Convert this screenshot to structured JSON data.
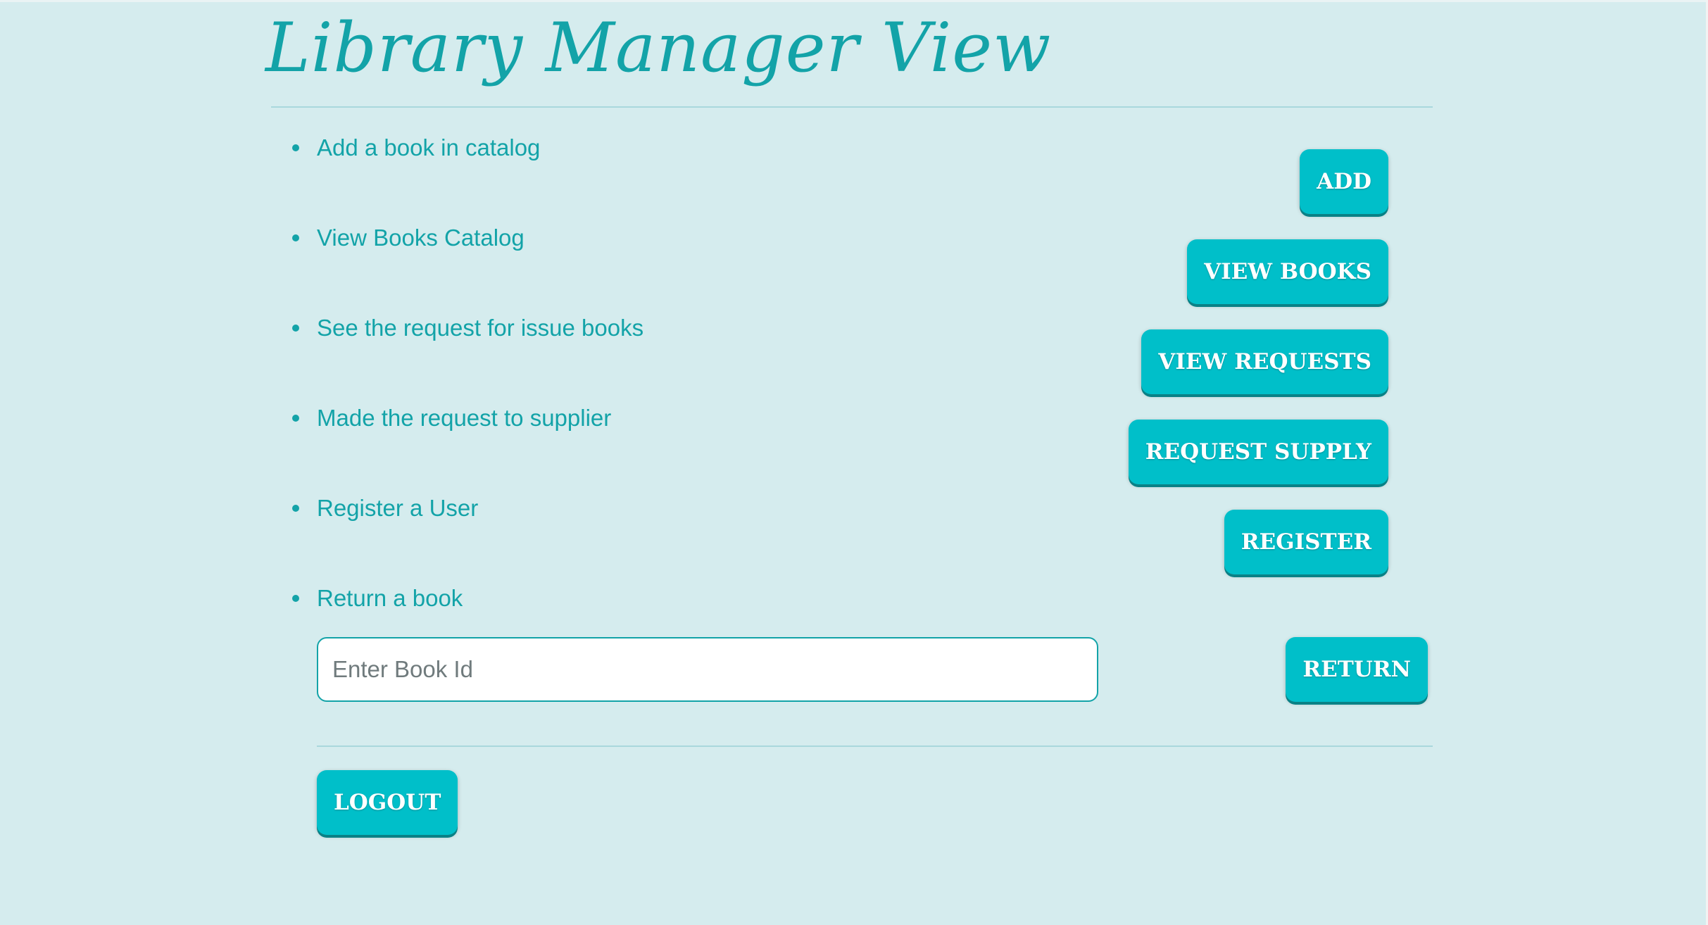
{
  "page": {
    "title": "Library Manager View"
  },
  "menu": {
    "items": [
      {
        "label": "Add a book in catalog",
        "button": "ADD"
      },
      {
        "label": "View Books Catalog",
        "button": "VIEW BOOKS"
      },
      {
        "label": "See the request for issue books",
        "button": "VIEW REQUESTS"
      },
      {
        "label": "Made the request to supplier",
        "button": "REQUEST SUPPLY"
      },
      {
        "label": "Register a User",
        "button": "REGISTER"
      },
      {
        "label": "Return a book",
        "button": "RETURN"
      }
    ]
  },
  "return_form": {
    "placeholder": "Enter Book Id",
    "value": ""
  },
  "logout": {
    "label": "LOGOUT"
  },
  "colors": {
    "background": "#d5ecee",
    "accent": "#13a3a8",
    "button": "#00bfc9",
    "button_text": "#ffffff"
  }
}
